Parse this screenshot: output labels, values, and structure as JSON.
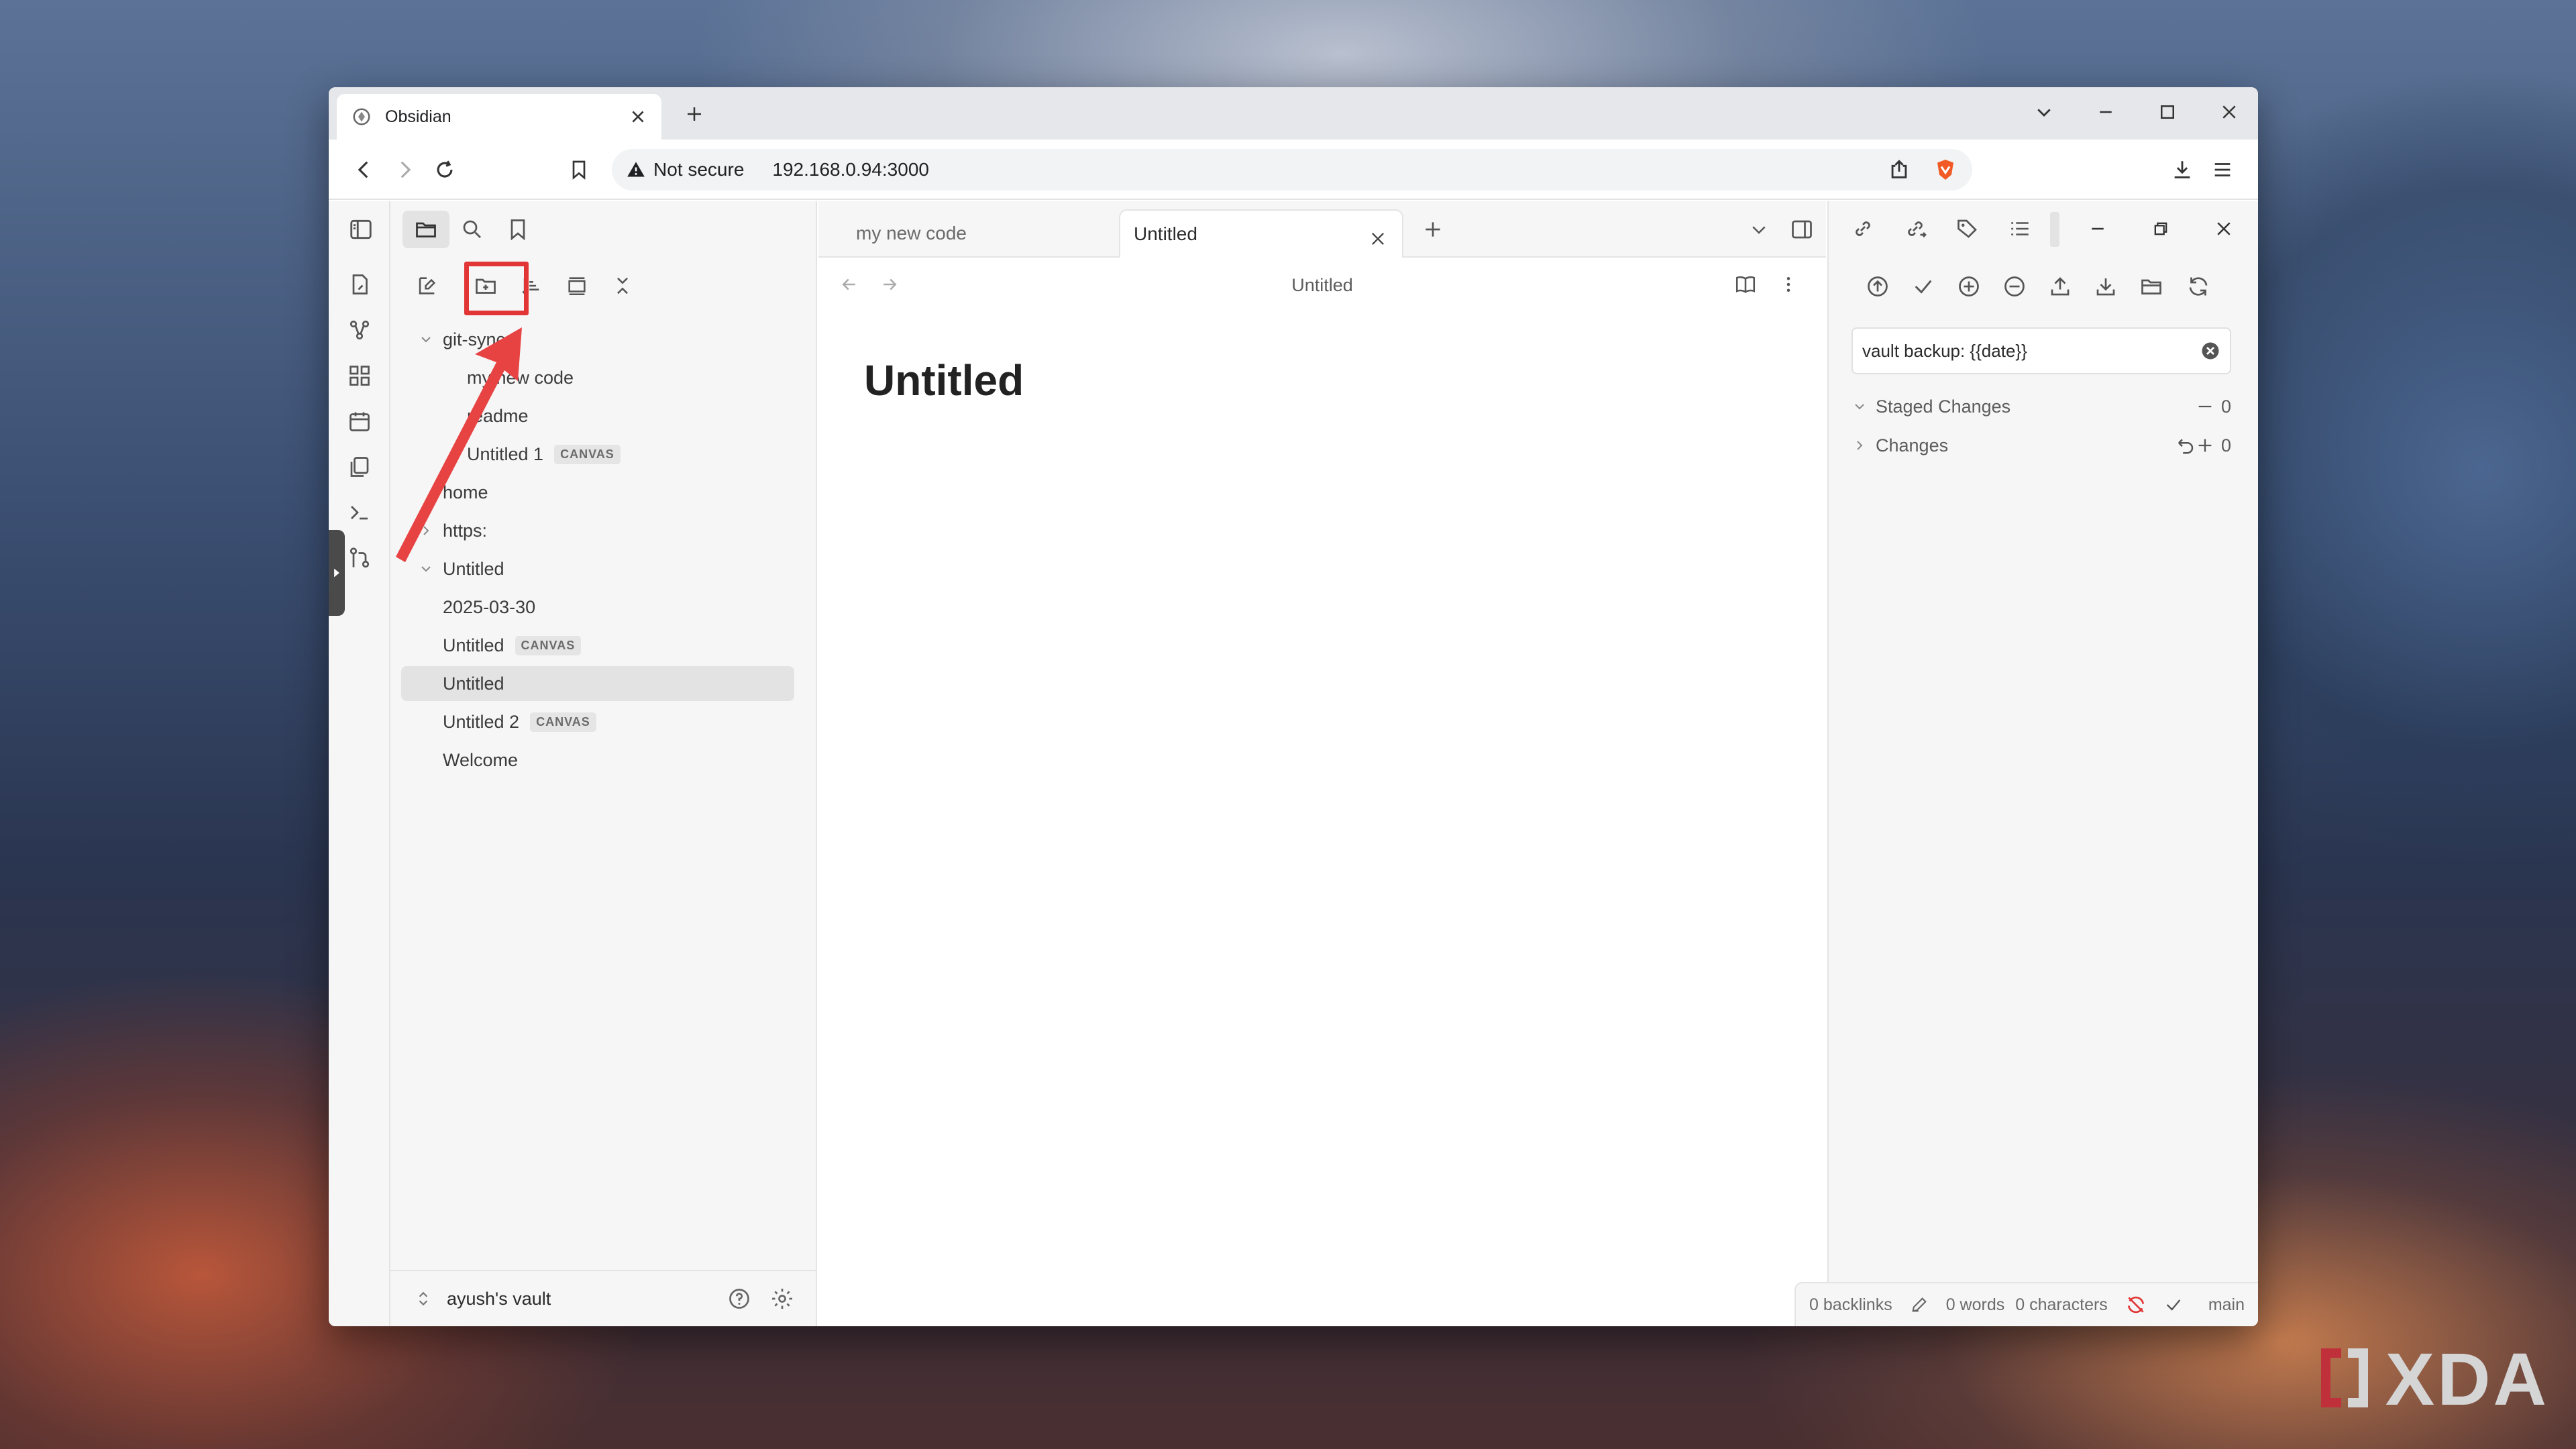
{
  "browser": {
    "tab_title": "Obsidian",
    "address": {
      "security_label": "Not secure",
      "url": "192.168.0.94:3000"
    }
  },
  "sidebar": {
    "tree": [
      {
        "label": "git-sync",
        "type": "folder",
        "expanded": true
      },
      {
        "label": "my new code",
        "type": "file"
      },
      {
        "label": "readme",
        "type": "file"
      },
      {
        "label": "Untitled 1",
        "type": "file",
        "badge": "CANVAS"
      },
      {
        "label": "home",
        "type": "file"
      },
      {
        "label": "https:",
        "type": "folder",
        "expanded": false
      },
      {
        "label": "Untitled",
        "type": "folder",
        "expanded": true
      },
      {
        "label": "2025-03-30",
        "type": "file"
      },
      {
        "label": "Untitled",
        "type": "file",
        "badge": "CANVAS"
      },
      {
        "label": "Untitled",
        "type": "file",
        "active": true
      },
      {
        "label": "Untitled 2",
        "type": "file",
        "badge": "CANVAS"
      },
      {
        "label": "Welcome",
        "type": "file"
      }
    ],
    "vault_name": "ayush's vault"
  },
  "main": {
    "tabs": [
      {
        "label": "my new code",
        "active": false
      },
      {
        "label": "Untitled",
        "active": true
      }
    ],
    "view_title": "Untitled",
    "note_title": "Untitled"
  },
  "git_panel": {
    "commit_message": "vault backup: {{date}}",
    "staged_changes": {
      "label": "Staged Changes",
      "count": "0"
    },
    "changes": {
      "label": "Changes",
      "count": "0"
    }
  },
  "status_bar": {
    "backlinks": "0 backlinks",
    "words": "0 words",
    "characters": "0 characters",
    "branch": "main"
  },
  "annotation": {
    "color": "#e23636"
  },
  "watermark": {
    "text": "XDA"
  },
  "colors": {
    "accent_red": "#e23636",
    "brave_orange": "#f15a24",
    "sidebar_bg": "#f6f6f6"
  }
}
